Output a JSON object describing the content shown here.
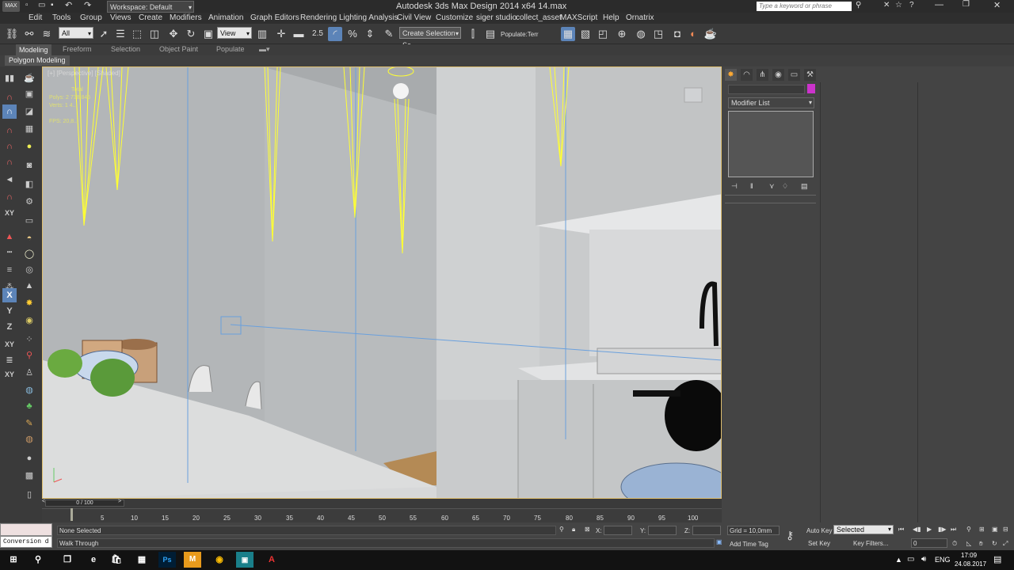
{
  "titlebar": {
    "workspace": "Workspace: Default",
    "title": "Autodesk 3ds Max Design 2014 x64     14.max",
    "search_placeholder": "Type a keyword or phrase"
  },
  "menu": [
    "Edit",
    "Tools",
    "Group",
    "Views",
    "Create",
    "Modifiers",
    "Animation",
    "Graph Editors",
    "Rendering",
    "Lighting Analysis",
    "Civil View",
    "Customize",
    "siger studio",
    "collect_asset",
    "MAXScript",
    "Help",
    "Ornatrix"
  ],
  "toolbar": {
    "filter_select": "All",
    "view_select": "View",
    "snap_label": "2.5",
    "named_selection": "Create Selection Se",
    "populate_label": "Populate:Terr"
  },
  "ribbon": {
    "tabs": [
      "Modeling",
      "Freeform",
      "Selection",
      "Object Paint",
      "Populate"
    ],
    "active_tab": "Modeling",
    "panel_label": "Polygon Modeling"
  },
  "viewport": {
    "label": "[+] [Perspective] [Shaded]",
    "stats": {
      "total": "Total",
      "polys_label": "Polys:",
      "polys": "2 738 845",
      "verts_label": "Verts:",
      "verts": "1 4...",
      "fps_label": "FPS:",
      "fps": "20,8..."
    }
  },
  "command_panel": {
    "modifier_list": "Modifier List"
  },
  "timeline": {
    "frame_indicator": "0 / 100",
    "ticks": [
      "5",
      "10",
      "15",
      "20",
      "25",
      "30",
      "35",
      "40",
      "45",
      "50",
      "55",
      "60",
      "65",
      "70",
      "75",
      "80",
      "85",
      "90",
      "95",
      "100"
    ]
  },
  "status": {
    "script_field": "Conversion d",
    "selection_status": "None Selected",
    "prompt": "Walk Through",
    "x_label": "X:",
    "y_label": "Y:",
    "z_label": "Z:",
    "grid": "Grid = 10,0mm",
    "auto_key": "Auto Key",
    "key_mode": "Selected",
    "set_key": "Set Key",
    "key_filters": "Key Filters...",
    "frame_value": "0",
    "add_time_tag": "Add Time Tag"
  },
  "taskbar": {
    "language": "ENG",
    "time": "17:09",
    "date": "24.08.2017"
  },
  "colors": {
    "accent": "#5c84b8",
    "light_wire": "#ffff33",
    "viewport_border": "#e0c070"
  }
}
